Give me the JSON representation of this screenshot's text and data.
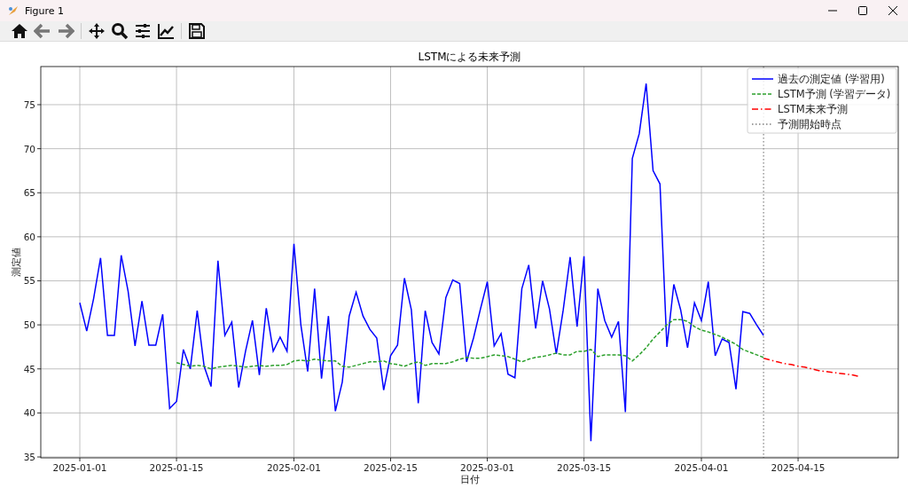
{
  "window": {
    "title": "Figure 1"
  },
  "toolbar": {
    "back_enabled": false,
    "forward_enabled": false
  },
  "chart_data": {
    "type": "line",
    "title": "LSTMによる未来予測",
    "xlabel": "日付",
    "ylabel": "測定値",
    "categories": [
      "2025-01-01",
      null,
      null,
      null,
      null,
      null,
      null,
      null,
      null,
      null,
      null,
      null,
      null,
      null,
      "2025-01-15",
      null,
      null,
      null,
      null,
      null,
      null,
      null,
      null,
      null,
      null,
      null,
      null,
      null,
      null,
      null,
      null,
      "2025-02-01",
      null,
      null,
      null,
      null,
      null,
      null,
      null,
      null,
      null,
      null,
      null,
      null,
      null,
      "2025-02-15",
      null,
      null,
      null,
      null,
      null,
      null,
      null,
      null,
      null,
      null,
      null,
      null,
      null,
      "2025-03-01",
      null,
      null,
      null,
      null,
      null,
      null,
      null,
      null,
      null,
      null,
      null,
      null,
      null,
      "2025-03-15",
      null,
      null,
      null,
      null,
      null,
      null,
      null,
      null,
      null,
      null,
      null,
      null,
      null,
      null,
      null,
      null,
      "2025-04-01",
      null,
      null,
      null,
      null,
      null,
      null,
      null,
      null,
      null,
      null,
      null,
      null,
      null,
      "2025-04-15",
      null,
      null,
      null,
      null,
      null,
      null,
      null,
      null,
      null
    ],
    "series": [
      {
        "name": "過去の測定値 (学習用)",
        "color": "#0000ff",
        "line_style": "solid",
        "values": [
          52.5,
          49.3,
          53,
          57.6,
          48.8,
          48.8,
          57.9,
          53.8,
          47.6,
          52.7,
          47.7,
          47.7,
          51.2,
          40.5,
          41.3,
          47.2,
          45,
          51.6,
          45.3,
          43,
          57.3,
          48.8,
          50.3,
          42.9,
          47,
          50.5,
          44.3,
          51.9,
          47,
          48.6,
          47,
          59.2,
          50,
          44.7,
          54.1,
          43.9,
          51,
          40.2,
          43.5,
          51,
          53.7,
          51,
          49.5,
          48.5,
          42.6,
          46.5,
          47.7,
          55.3,
          51.7,
          41.1,
          51.6,
          48,
          46.7,
          53.1,
          55.1,
          54.7,
          45.8,
          48.5,
          51.8,
          54.9,
          47.6,
          49,
          44.4,
          44,
          54.1,
          56.8,
          49.6,
          55,
          51.8,
          46.7,
          51.7,
          57.7,
          49.8,
          57.8,
          36.8,
          54.1,
          50.5,
          48.6,
          50.4,
          40.1,
          68.9,
          71.7,
          77.4,
          67.5,
          66,
          47.5,
          54.6,
          51.7,
          47.4,
          52.5,
          50.5,
          54.9,
          46.5,
          48.4,
          48,
          42.7,
          51.5,
          51.3,
          50,
          48.8,
          null,
          null,
          null,
          null,
          null,
          null,
          null,
          null,
          null,
          null,
          null,
          null,
          null,
          null
        ]
      },
      {
        "name": "LSTM予測 (学習データ)",
        "color": "#2ca02c",
        "line_style": "dashed",
        "values": [
          null,
          null,
          null,
          null,
          null,
          null,
          null,
          null,
          null,
          null,
          null,
          null,
          null,
          null,
          45.7,
          45.5,
          45.3,
          45.4,
          45.3,
          45.0,
          45.2,
          45.3,
          45.4,
          45.3,
          45.2,
          45.3,
          45.4,
          45.3,
          45.4,
          45.4,
          45.5,
          45.9,
          46.0,
          45.9,
          46.1,
          46.0,
          45.9,
          45.9,
          45.3,
          45.2,
          45.4,
          45.6,
          45.8,
          45.8,
          45.9,
          45.6,
          45.5,
          45.3,
          45.6,
          45.8,
          45.4,
          45.6,
          45.6,
          45.6,
          45.8,
          46.1,
          46.3,
          46.2,
          46.2,
          46.4,
          46.6,
          46.5,
          46.4,
          46.1,
          45.8,
          46.1,
          46.3,
          46.4,
          46.6,
          46.8,
          46.6,
          46.6,
          47.0,
          47.0,
          47.2,
          46.4,
          46.6,
          46.6,
          46.6,
          46.5,
          45.9,
          46.6,
          47.4,
          48.4,
          49.2,
          50.0,
          50.6,
          50.6,
          50.4,
          49.8,
          49.4,
          49.2,
          48.9,
          48.6,
          48.2,
          47.8,
          47.2,
          46.9,
          46.6,
          46.3,
          null,
          null,
          null,
          null,
          null,
          null,
          null,
          null,
          null,
          null,
          null,
          null,
          null,
          null
        ]
      },
      {
        "name": "LSTM未来予測",
        "color": "#ff0000",
        "line_style": "dashdot",
        "values": [
          null,
          null,
          null,
          null,
          null,
          null,
          null,
          null,
          null,
          null,
          null,
          null,
          null,
          null,
          null,
          null,
          null,
          null,
          null,
          null,
          null,
          null,
          null,
          null,
          null,
          null,
          null,
          null,
          null,
          null,
          null,
          null,
          null,
          null,
          null,
          null,
          null,
          null,
          null,
          null,
          null,
          null,
          null,
          null,
          null,
          null,
          null,
          null,
          null,
          null,
          null,
          null,
          null,
          null,
          null,
          null,
          null,
          null,
          null,
          null,
          null,
          null,
          null,
          null,
          null,
          null,
          null,
          null,
          null,
          null,
          null,
          null,
          null,
          null,
          null,
          null,
          null,
          null,
          null,
          null,
          null,
          null,
          null,
          null,
          null,
          null,
          null,
          null,
          null,
          null,
          null,
          null,
          null,
          null,
          null,
          null,
          null,
          null,
          null,
          46.2,
          46.0,
          45.8,
          45.6,
          45.5,
          45.3,
          45.2,
          45.0,
          44.8,
          44.7,
          44.6,
          44.5,
          44.4,
          44.3,
          44.1
        ]
      }
    ],
    "legend": {
      "items": [
        {
          "label": "予測開始時点",
          "color": "#808080",
          "line_style": "dotted"
        }
      ]
    },
    "grid": true,
    "ylim": [
      34.9,
      79.33
    ],
    "yticks": [
      35,
      40,
      45,
      50,
      55,
      60,
      65,
      70,
      75
    ]
  }
}
